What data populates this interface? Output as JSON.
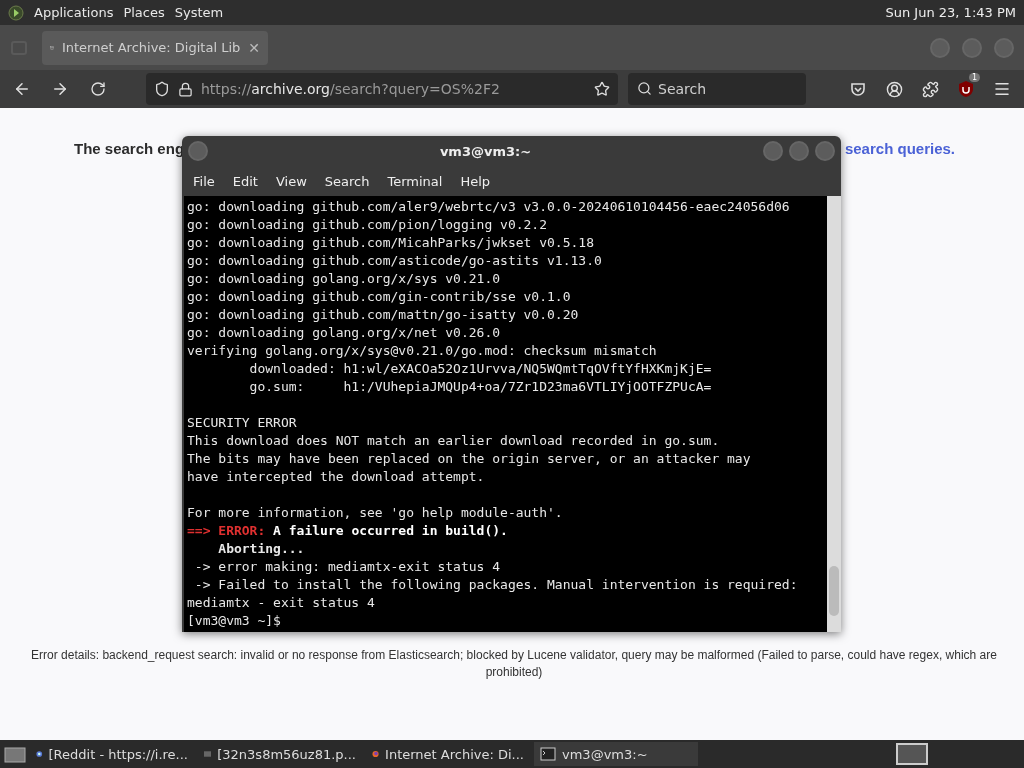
{
  "top_panel": {
    "menus": [
      "Applications",
      "Places",
      "System"
    ],
    "clock": "Sun Jun 23, 1:43 PM"
  },
  "browser": {
    "tabs": [
      {
        "title": "Internet Archive: Digital Lib",
        "close": "✕",
        "selected": true
      }
    ],
    "url": {
      "scheme": "https://",
      "host": "archive.org",
      "path": "/search?query=OS%2F2"
    },
    "search": {
      "placeholder": "Search"
    },
    "extension_badge": "1"
  },
  "page": {
    "heading_start": "The search eng",
    "heading_link": "search queries.",
    "error_details": "Error details: backend_request search: invalid or no response from Elasticsearch; blocked by Lucene validator, query may be malformed (Failed to parse, could have regex, which are prohibited)"
  },
  "terminal": {
    "title": "vm3@vm3:~",
    "menu": [
      "File",
      "Edit",
      "View",
      "Search",
      "Terminal",
      "Help"
    ],
    "lines": [
      {
        "kind": "plain",
        "text": "go: downloading github.com/aler9/webrtc/v3 v3.0.0-20240610104456-eaec24056d06"
      },
      {
        "kind": "plain",
        "text": "go: downloading github.com/pion/logging v0.2.2"
      },
      {
        "kind": "plain",
        "text": "go: downloading github.com/MicahParks/jwkset v0.5.18"
      },
      {
        "kind": "plain",
        "text": "go: downloading github.com/asticode/go-astits v1.13.0"
      },
      {
        "kind": "plain",
        "text": "go: downloading golang.org/x/sys v0.21.0"
      },
      {
        "kind": "plain",
        "text": "go: downloading github.com/gin-contrib/sse v0.1.0"
      },
      {
        "kind": "plain",
        "text": "go: downloading github.com/mattn/go-isatty v0.0.20"
      },
      {
        "kind": "plain",
        "text": "go: downloading golang.org/x/net v0.26.0"
      },
      {
        "kind": "plain",
        "text": "verifying golang.org/x/sys@v0.21.0/go.mod: checksum mismatch"
      },
      {
        "kind": "plain",
        "text": "        downloaded: h1:wl/eXACOa52Oz1Urvva/NQ5WQmtTqOVftYfHXKmjKjE="
      },
      {
        "kind": "plain",
        "text": "        go.sum:     h1:/VUhepiaJMQUp4+oa/7Zr1D23ma6VTLIYjOOTFZPUcA="
      },
      {
        "kind": "blank"
      },
      {
        "kind": "plain",
        "text": "SECURITY ERROR"
      },
      {
        "kind": "plain",
        "text": "This download does NOT match an earlier download recorded in go.sum."
      },
      {
        "kind": "plain",
        "text": "The bits may have been replaced on the origin server, or an attacker may"
      },
      {
        "kind": "plain",
        "text": "have intercepted the download attempt."
      },
      {
        "kind": "blank"
      },
      {
        "kind": "plain",
        "text": "For more information, see 'go help module-auth'."
      },
      {
        "kind": "error",
        "prefix": "==>",
        "label": "ERROR:",
        "text": "A failure occurred in build()."
      },
      {
        "kind": "bold",
        "text": "    Aborting..."
      },
      {
        "kind": "plain",
        "text": " -> error making: mediamtx-exit status 4"
      },
      {
        "kind": "plain",
        "text": " -> Failed to install the following packages. Manual intervention is required:"
      },
      {
        "kind": "plain",
        "text": "mediamtx - exit status 4"
      },
      {
        "kind": "plain",
        "text": "[vm3@vm3 ~]$ "
      }
    ]
  },
  "taskbar": {
    "tasks": [
      {
        "kind": "chrome",
        "label": "[Reddit - https://i.re...",
        "selected": false
      },
      {
        "kind": "image",
        "label": "[32n3s8m56uz81.p...",
        "selected": false
      },
      {
        "kind": "firefox",
        "label": "Internet Archive: Di...",
        "selected": false
      },
      {
        "kind": "terminal",
        "label": "vm3@vm3:~",
        "selected": true
      }
    ]
  }
}
